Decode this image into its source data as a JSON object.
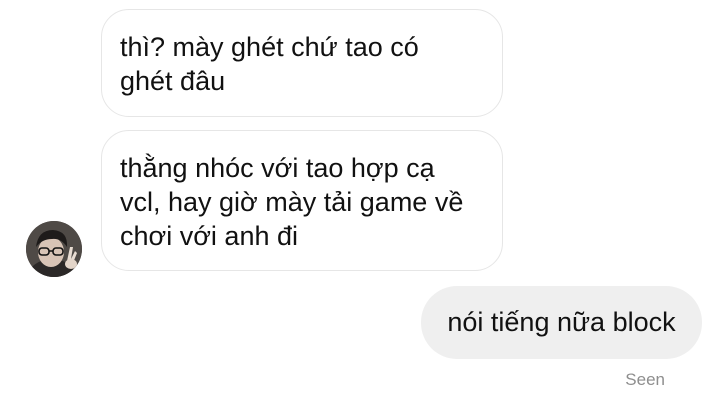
{
  "messages": [
    {
      "direction": "incoming",
      "lines": [
        "thì? mày ghét chứ tao có",
        "ghét đâu"
      ]
    },
    {
      "direction": "incoming",
      "lines": [
        "thằng nhóc với tao hợp cạ",
        "vcl, hay giờ mày tải game về",
        "chơi với anh đi"
      ]
    },
    {
      "direction": "outgoing",
      "text": "nói tiếng nữa block"
    }
  ],
  "seen_label": "Seen",
  "colors": {
    "incoming_bubble_bg": "#ffffff",
    "incoming_bubble_border": "#e6e6e6",
    "outgoing_bubble_bg": "#efefef",
    "text": "#111111",
    "seen_text": "#8e8e8e"
  }
}
